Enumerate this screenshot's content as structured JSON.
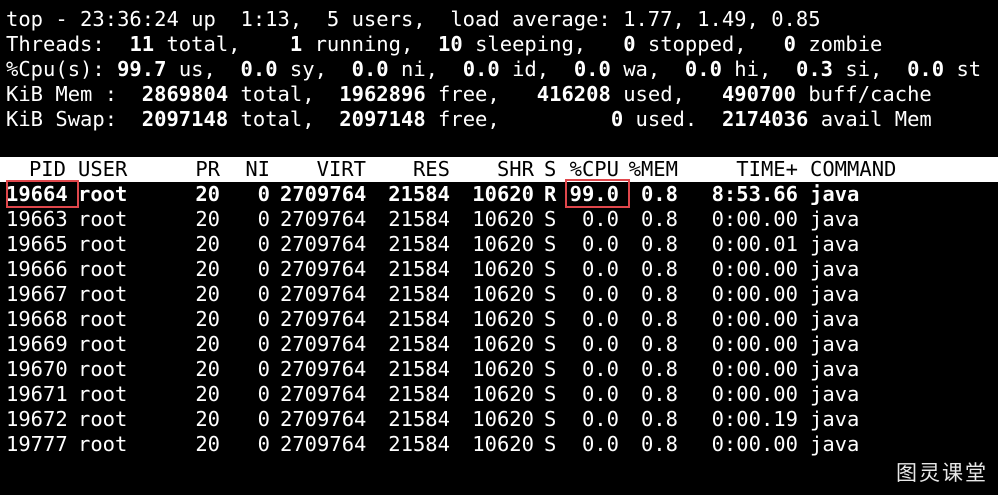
{
  "summary": {
    "line1": "top - 23:36:24 up  1:13,  5 users,  load average: 1.77, 1.49, 0.85",
    "threads": {
      "label": "Threads:",
      "total_value": "11",
      "total_label": "total,",
      "running_value": "1",
      "running_label": "running,",
      "sleeping_value": "10",
      "sleeping_label": "sleeping,",
      "stopped_value": "0",
      "stopped_label": "stopped,",
      "zombie_value": "0",
      "zombie_label": "zombie"
    },
    "cpu": {
      "label": "%Cpu(s):",
      "us_value": "99.7",
      "us_label": "us,",
      "sy_value": "0.0",
      "sy_label": "sy,",
      "ni_value": "0.0",
      "ni_label": "ni,",
      "id_value": "0.0",
      "id_label": "id,",
      "wa_value": "0.0",
      "wa_label": "wa,",
      "hi_value": "0.0",
      "hi_label": "hi,",
      "si_value": "0.3",
      "si_label": "si,",
      "st_value": "0.0",
      "st_label": "st"
    },
    "mem": {
      "label": "KiB Mem :",
      "total_value": "2869804",
      "total_label": "total,",
      "free_value": "1962896",
      "free_label": "free,",
      "used_value": "416208",
      "used_label": "used,",
      "buff_value": "490700",
      "buff_label": "buff/cache"
    },
    "swap": {
      "label": "KiB Swap:",
      "total_value": "2097148",
      "total_label": "total,",
      "free_value": "2097148",
      "free_label": "free,",
      "used_value": "0",
      "used_label": "used.",
      "avail_value": "2174036",
      "avail_label": "avail Mem"
    }
  },
  "table": {
    "columns": [
      "PID",
      "USER",
      "PR",
      "NI",
      "VIRT",
      "RES",
      "SHR",
      "S",
      "%CPU",
      "%MEM",
      "TIME+",
      "COMMAND"
    ],
    "rows": [
      [
        "19664",
        "root",
        "20",
        "0",
        "2709764",
        "21584",
        "10620",
        "R",
        "99.0",
        "0.8",
        "8:53.66",
        "java"
      ],
      [
        "19663",
        "root",
        "20",
        "0",
        "2709764",
        "21584",
        "10620",
        "S",
        "0.0",
        "0.8",
        "0:00.00",
        "java"
      ],
      [
        "19665",
        "root",
        "20",
        "0",
        "2709764",
        "21584",
        "10620",
        "S",
        "0.0",
        "0.8",
        "0:00.01",
        "java"
      ],
      [
        "19666",
        "root",
        "20",
        "0",
        "2709764",
        "21584",
        "10620",
        "S",
        "0.0",
        "0.8",
        "0:00.00",
        "java"
      ],
      [
        "19667",
        "root",
        "20",
        "0",
        "2709764",
        "21584",
        "10620",
        "S",
        "0.0",
        "0.8",
        "0:00.00",
        "java"
      ],
      [
        "19668",
        "root",
        "20",
        "0",
        "2709764",
        "21584",
        "10620",
        "S",
        "0.0",
        "0.8",
        "0:00.00",
        "java"
      ],
      [
        "19669",
        "root",
        "20",
        "0",
        "2709764",
        "21584",
        "10620",
        "S",
        "0.0",
        "0.8",
        "0:00.00",
        "java"
      ],
      [
        "19670",
        "root",
        "20",
        "0",
        "2709764",
        "21584",
        "10620",
        "S",
        "0.0",
        "0.8",
        "0:00.00",
        "java"
      ],
      [
        "19671",
        "root",
        "20",
        "0",
        "2709764",
        "21584",
        "10620",
        "S",
        "0.0",
        "0.8",
        "0:00.00",
        "java"
      ],
      [
        "19672",
        "root",
        "20",
        "0",
        "2709764",
        "21584",
        "10620",
        "S",
        "0.0",
        "0.8",
        "0:00.19",
        "java"
      ],
      [
        "19777",
        "root",
        "20",
        "0",
        "2709764",
        "21584",
        "10620",
        "S",
        "0.0",
        "0.8",
        "0:00.00",
        "java"
      ]
    ]
  },
  "watermark": "图灵课堂",
  "colors": {
    "background": "#000000",
    "text": "#ffffff",
    "header_bar": "#ffffff",
    "highlight": "#e0474c"
  }
}
